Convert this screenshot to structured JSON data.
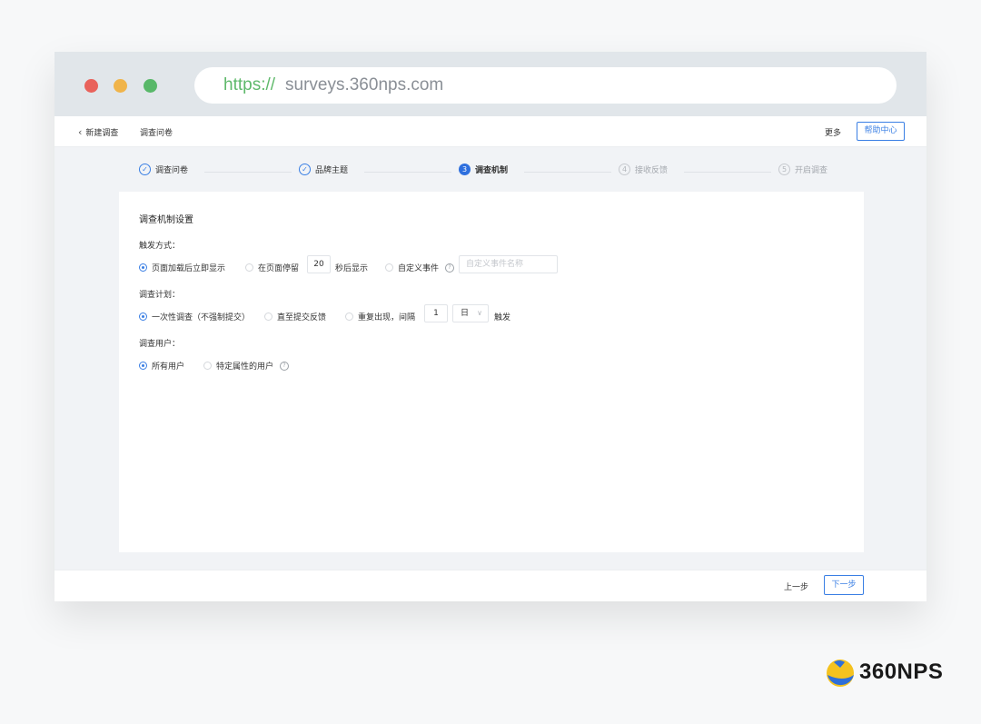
{
  "browser": {
    "url_scheme": "https://",
    "url_host": "surveys.360nps.com"
  },
  "topbar": {
    "back_label": "新建调查",
    "current_label": "调查问卷",
    "more_label": "更多",
    "help_label": "帮助中心"
  },
  "steps": [
    {
      "number": "1",
      "label": "调查问卷",
      "state": "done"
    },
    {
      "number": "2",
      "label": "品牌主题",
      "state": "done"
    },
    {
      "number": "3",
      "label": "调查机制",
      "state": "active"
    },
    {
      "number": "4",
      "label": "接收反馈",
      "state": "todo"
    },
    {
      "number": "5",
      "label": "开启调查",
      "state": "todo"
    }
  ],
  "panel": {
    "title": "调查机制设置",
    "trigger": {
      "label": "触发方式：",
      "opt1": "页面加载后立即显示",
      "opt2_prefix": "在页面停留",
      "opt2_value": "20",
      "opt2_suffix": "秒后显示",
      "opt3": "自定义事件",
      "opt3_placeholder": "自定义事件名称"
    },
    "plan": {
      "label": "调查计划：",
      "opt1": "一次性调查（不强制提交）",
      "opt2": "直至提交反馈",
      "opt3_prefix": "重复出现，间隔",
      "interval_value": "1",
      "unit_value": "日",
      "opt3_suffix": "触发"
    },
    "users": {
      "label": "调查用户：",
      "opt1": "所有用户",
      "opt2": "特定属性的用户"
    }
  },
  "footer": {
    "prev_label": "上一步",
    "next_label": "下一步"
  },
  "brand": {
    "name": "360NPS"
  },
  "colors": {
    "accent": "#3a7fe4",
    "url_scheme": "#5fb96b"
  }
}
